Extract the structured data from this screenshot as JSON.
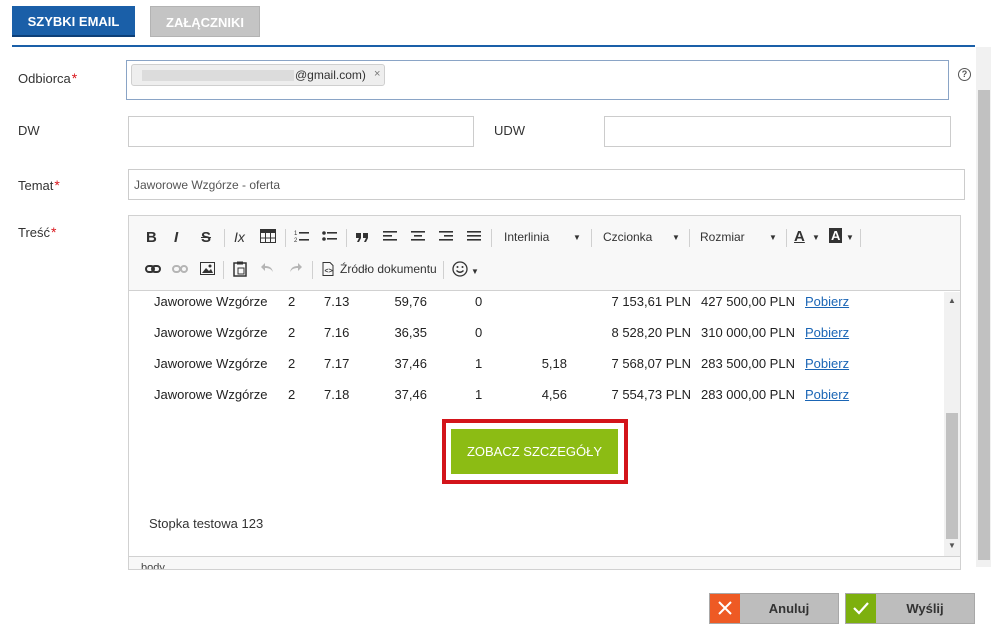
{
  "tabs": {
    "quick_email": "SZYBKI EMAIL",
    "attachments": "ZAŁĄCZNIKI"
  },
  "form": {
    "recipient_label": "Odbiorca",
    "recipient_chip_visible_text": "@gmail.com)",
    "chip_remove": "×",
    "help": "?",
    "cc_label": "DW",
    "bcc_label": "UDW",
    "subject_label": "Temat",
    "subject_value": "Jaworowe Wzgórze - oferta",
    "body_label": "Treść",
    "required_mark": "*"
  },
  "toolbar": {
    "bold": "B",
    "italic": "I",
    "strike": "S",
    "remove_format": "Ix",
    "table": "table-icon",
    "numbered_list": "numbered-list-icon",
    "bullet_list": "bullet-list-icon",
    "blockquote": "”",
    "line_height": "Interlinia",
    "font": "Czcionka",
    "size": "Rozmiar",
    "text_color": "A",
    "bg_color": "A",
    "source": "Źródło dokumentu"
  },
  "table_rows": [
    {
      "name": "Jaworowe Wzgórze",
      "rooms": "2",
      "number": "7.13",
      "area": "59,76",
      "floor": "0",
      "extra": "",
      "price_m2": "7 153,61 PLN",
      "price": "427 500,00 PLN",
      "link": "Pobierz"
    },
    {
      "name": "Jaworowe Wzgórze",
      "rooms": "2",
      "number": "7.16",
      "area": "36,35",
      "floor": "0",
      "extra": "",
      "price_m2": "8 528,20 PLN",
      "price": "310 000,00 PLN",
      "link": "Pobierz"
    },
    {
      "name": "Jaworowe Wzgórze",
      "rooms": "2",
      "number": "7.17",
      "area": "37,46",
      "floor": "1",
      "extra": "5,18",
      "price_m2": "7 568,07 PLN",
      "price": "283 500,00 PLN",
      "link": "Pobierz"
    },
    {
      "name": "Jaworowe Wzgórze",
      "rooms": "2",
      "number": "7.18",
      "area": "37,46",
      "floor": "1",
      "extra": "4,56",
      "price_m2": "7 554,73 PLN",
      "price": "283 000,00 PLN",
      "link": "Pobierz"
    }
  ],
  "cta": "ZOBACZ SZCZEGÓŁY",
  "footer_text": "Stopka testowa 123",
  "editor_path": "body",
  "actions": {
    "cancel": "Anuluj",
    "send": "Wyślij"
  },
  "colors": {
    "primary": "#1a5fa8",
    "cta_green": "#8cbc14",
    "highlight_red": "#d3141a",
    "cancel_orange": "#ee5a24",
    "send_green": "#7db00e"
  }
}
